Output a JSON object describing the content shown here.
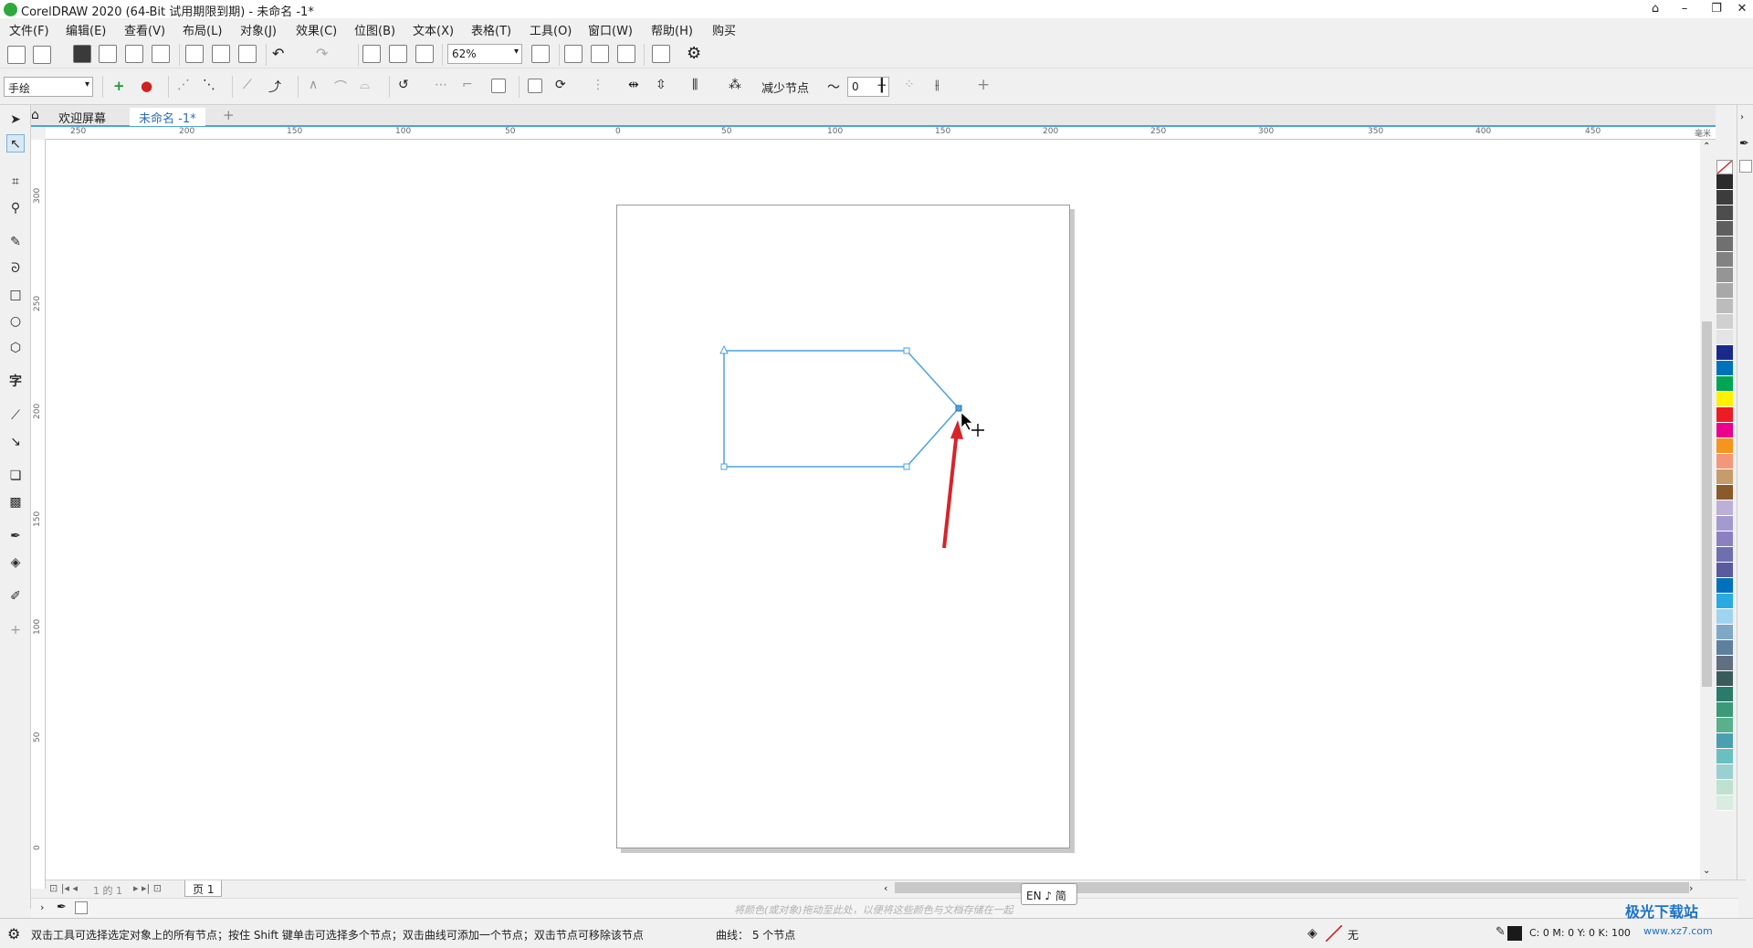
{
  "title": "CorelDRAW 2020 (64-Bit 试用期限到期) - 未命名 -1*",
  "menu": [
    "文件(F)",
    "编辑(E)",
    "查看(V)",
    "布局(L)",
    "对象(J)",
    "效果(C)",
    "位图(B)",
    "文本(X)",
    "表格(T)",
    "工具(O)",
    "窗口(W)",
    "帮助(H)",
    "购买"
  ],
  "toolbar": {
    "zoom_value": "62%",
    "tool_mode": "手绘",
    "reduce_nodes_label": "减少节点",
    "smoothing_value": "0"
  },
  "tabs": [
    "欢迎屏幕",
    "未命名 -1*"
  ],
  "ruler": {
    "horizontal_ticks": [
      "250",
      "200",
      "150",
      "100",
      "50",
      "0",
      "50",
      "100",
      "150",
      "200",
      "250",
      "300",
      "350",
      "400",
      "450"
    ],
    "unit": "毫米",
    "vertical_ticks": [
      "300",
      "250",
      "200",
      "150",
      "100",
      "50",
      "0"
    ]
  },
  "page_tab": "页 1",
  "page_nav": "1 的 1",
  "doc_palette_hint": "将颜色(或对象)拖动至此处，以便将这些颜色与文档存储在一起",
  "ime": "EN ♪ 简",
  "status": {
    "hint": "双击工具可选择选定对象上的所有节点；按住 Shift 键单击可选择多个节点；双击曲线可添加一个节点；双击节点可移除该节点",
    "curve_info": "曲线：  5 个节点",
    "fill_label": "无",
    "color_values": "C: 0 M: 0 Y: 0 K: 100"
  },
  "palette_colors": [
    "#2b2b2b",
    "#3c3c3c",
    "#4d4d4d",
    "#5e5e5e",
    "#707070",
    "#828282",
    "#959595",
    "#a8a8a8",
    "#bcbcbc",
    "#d0d0d0",
    "#e4e4e4",
    "#1a2a8c",
    "#0072bc",
    "#00a651",
    "#fff200",
    "#ed1c24",
    "#ec008c",
    "#f7941d",
    "#f69679",
    "#c69c6d",
    "#8b5a2b",
    "#bcb0d6",
    "#a39ad0",
    "#8c7fc2",
    "#6f6fb0",
    "#5a5a9e",
    "#0071bc",
    "#29abe2",
    "#9ed4f0",
    "#7fa7c7",
    "#5f7f9f",
    "#607080",
    "#3b5b5b",
    "#2b7b6b",
    "#3a9a7a",
    "#5ab08a",
    "#4aa0b0",
    "#6ac0c0",
    "#9ad0d0",
    "#c0e0d0",
    "#d8ece0"
  ],
  "watermark": "极光下载站",
  "watermark_url": "www.xz7.com"
}
